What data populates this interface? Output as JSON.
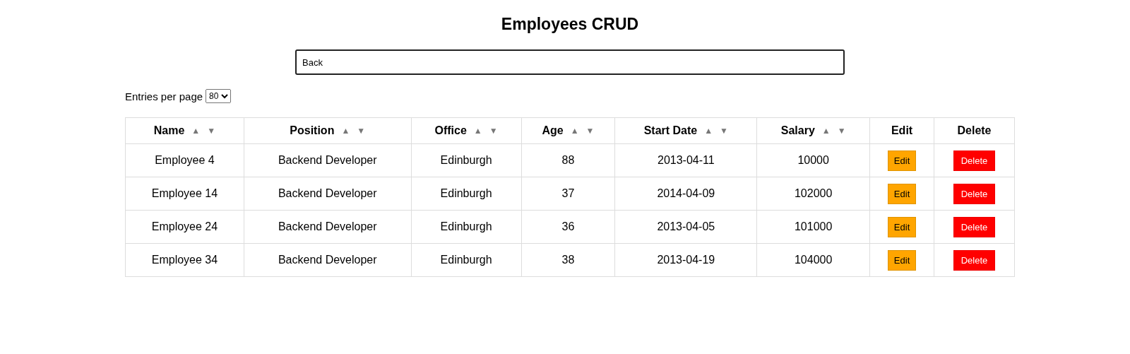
{
  "title": "Employees CRUD",
  "search": {
    "value": "Back"
  },
  "entries": {
    "label": "Entries per page",
    "value": "80"
  },
  "table": {
    "columns": [
      {
        "label": "Name",
        "up": "▲",
        "down": "▼"
      },
      {
        "label": "Position",
        "up": "▲",
        "down": "▼"
      },
      {
        "label": "Office",
        "up": "▲",
        "down": "▼"
      },
      {
        "label": "Age",
        "up": "▲",
        "down": "▼"
      },
      {
        "label": "Start Date",
        "up": "▲",
        "down": "▼"
      },
      {
        "label": "Salary",
        "up": "▲",
        "down": "▼"
      },
      {
        "label": "Edit"
      },
      {
        "label": "Delete"
      }
    ],
    "rows": [
      {
        "cells": [
          "Employee 4",
          "Backend Developer",
          "Edinburgh",
          "88",
          "2013-04-11",
          "10000"
        ],
        "edit": "Edit",
        "delete": "Delete"
      },
      {
        "cells": [
          "Employee 14",
          "Backend Developer",
          "Edinburgh",
          "37",
          "2014-04-09",
          "102000"
        ],
        "edit": "Edit",
        "delete": "Delete"
      },
      {
        "cells": [
          "Employee 24",
          "Backend Developer",
          "Edinburgh",
          "36",
          "2013-04-05",
          "101000"
        ],
        "edit": "Edit",
        "delete": "Delete"
      },
      {
        "cells": [
          "Employee 34",
          "Backend Developer",
          "Edinburgh",
          "38",
          "2013-04-19",
          "104000"
        ],
        "edit": "Edit",
        "delete": "Delete"
      }
    ]
  }
}
